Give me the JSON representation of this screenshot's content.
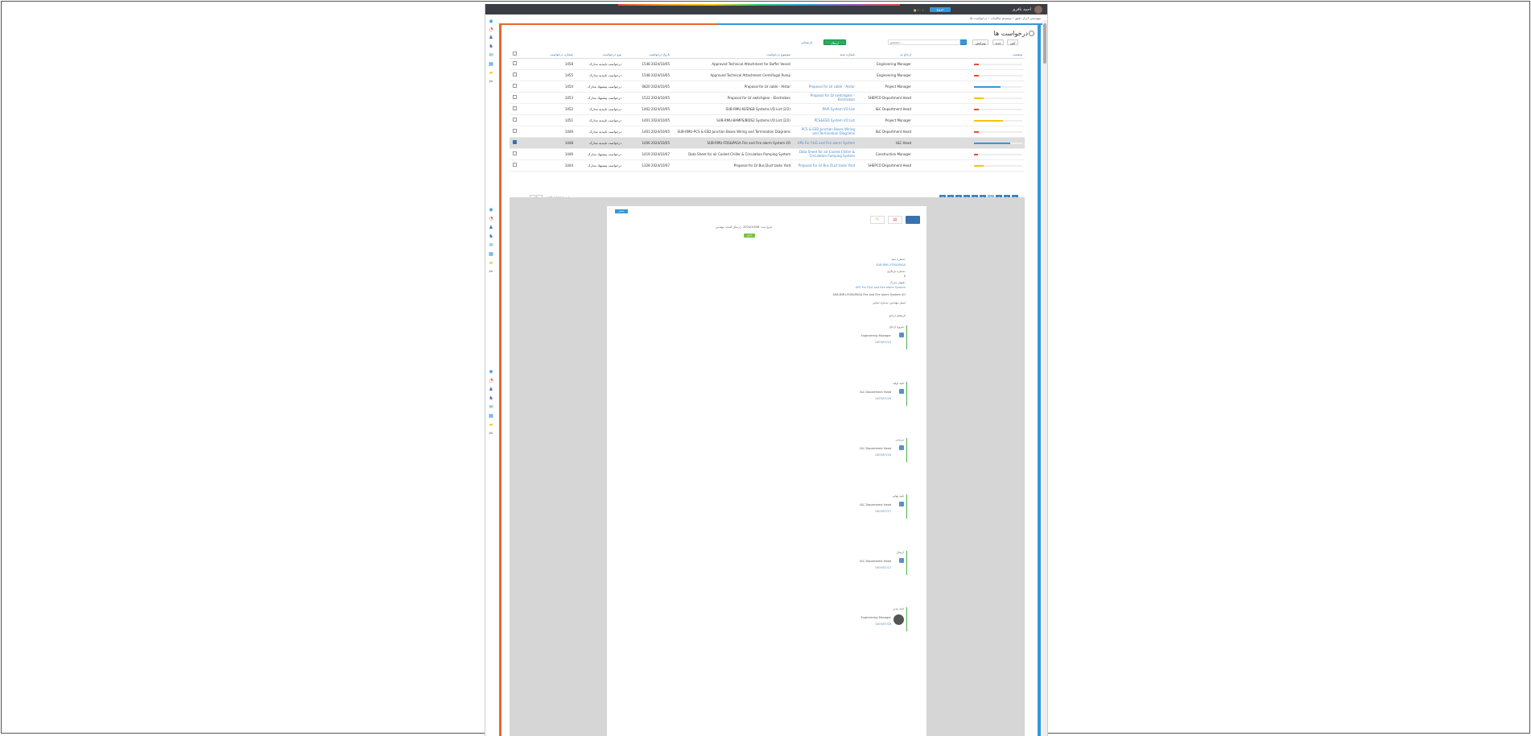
{
  "colors": {
    "accent": "#3498db",
    "orange": "#e8672c",
    "green": "#27ae60",
    "red": "#e74c3c",
    "yellow": "#f1c40f"
  },
  "topbar": {
    "user_name": "احمد باقری",
    "button_label": "خروج",
    "badges": "● ۱۰  ۱"
  },
  "breadcrumb": "مهندسی ابزار دقیق ‹ سیستم مکاتبات ‹ درخواست ها",
  "sidebar": {
    "icons": [
      "dashboard-icon",
      "alert-icon",
      "user-icon",
      "users-icon",
      "mail-icon",
      "calendar-icon",
      "folder-icon",
      "tools-icon"
    ]
  },
  "page": {
    "title": "درخواست ها"
  },
  "toolbar": {
    "buttons": [
      "کپی",
      "جدید",
      "ویرایش",
      "جستجو"
    ],
    "search_placeholder": "جستجو...",
    "green_label": "ارسال",
    "link_label": "بازنشانی"
  },
  "table": {
    "headers": [
      "شماره درخواست",
      "نوع درخواست",
      "تاریخ درخواست",
      "موضوع درخواست",
      "شماره سند",
      "ارجاع به",
      "وضعیت"
    ],
    "rows": [
      {
        "number": "1458",
        "type": "درخواست تاییدیه مدارک",
        "date": "1548 2024/10/05",
        "subject": "Approved Technical Attachment for Buffer Vessel",
        "doc": "",
        "assignee": "Engineering Manager",
        "progress": 0.1,
        "status_color": "#e74c3c",
        "selected": false
      },
      {
        "number": "1455",
        "type": "درخواست تاییدیه مدارک",
        "date": "1548 2024/10/05",
        "subject": "Approved Technical Attachment Centrifugal Pump",
        "doc": "",
        "assignee": "Engineering Manager",
        "progress": 0.1,
        "status_color": "#e74c3c",
        "selected": false
      },
      {
        "number": "1454",
        "type": "درخواست پیشنهاد مدارک",
        "date": "0820 2024/10/05",
        "subject": "Proposal for LV cable - Alstar",
        "doc": "Proposal for LV cable - Alstar",
        "assignee": "Project Manager",
        "progress": 0.55,
        "status_color": "#3498db",
        "selected": false
      },
      {
        "number": "1453",
        "type": "درخواست پیشنهاد مدارک",
        "date": "1522 2024/10/05",
        "subject": "Proposal for LV switchgear - Electroban",
        "doc": "Proposal for LV switchgear - Electroban",
        "assignee": "SHEPCO Department Head",
        "progress": 0.2,
        "status_color": "#f1c40f",
        "selected": false
      },
      {
        "number": "1452",
        "type": "درخواست تاییدیه مدارک",
        "date": "1402 2024/10/05",
        "subject": "SUB-RMU-KESP&B Systems I/O List (2/2)",
        "doc": "PA/R System I/O List",
        "assignee": "I&C Department Head",
        "progress": 0.1,
        "status_color": "#e74c3c",
        "selected": false
      },
      {
        "number": "1451",
        "type": "درخواست تاییدیه مدارک",
        "date": "1401 2024/10/05",
        "subject": "SUB-RMU-BAMPS/BIDS2 Systems I/O List (2/2)",
        "doc": "PCS&ESD System I/O List",
        "assignee": "Project Manager",
        "progress": 0.6,
        "status_color": "#f1c40f",
        "selected": false
      },
      {
        "number": "1449",
        "type": "درخواست تاییدیه مدارک",
        "date": "1401 2024/10/05",
        "subject": "SUB-RMU-PCS & ESD Junction Boxes Wiring and Termination Diagrams",
        "doc": "PCS & ESD Junction Boxes Wiring and Termination Diagrams",
        "assignee": "I&C Department Head",
        "progress": 0.1,
        "status_color": "#e74c3c",
        "selected": false
      },
      {
        "number": "1448",
        "type": "درخواست تاییدیه مدارک",
        "date": "1406 2024/10/05",
        "subject": "SUB-RMU-FDS&PAGA Fire and Fire alarm System I/O",
        "doc": "UPS For F&G and Fire alarm System",
        "assignee": "I&C Head",
        "progress": 0.75,
        "status_color": "#3498db",
        "selected": true
      },
      {
        "number": "1446",
        "type": "درخواست پیشنهاد مدارک",
        "date": "1419 2024/10/07",
        "subject": "Data Sheet for air Cooled Chiller & Circulation Pumping System",
        "doc": "Data Sheet for air Cooled Chiller & Circulation Pumping System",
        "assignee": "Construction Manager",
        "progress": 0.0,
        "status_color": "#e74c3c",
        "selected": false
      },
      {
        "number": "1444",
        "type": "درخواست پیشنهاد مدارک",
        "date": "1328 2024/10/07",
        "subject": "Proposal for LV Bus Duct tasks Yard",
        "doc": "Proposal for LV Bus Duct tasks Yard",
        "assignee": "SHEPCO Department Head",
        "progress": 0.2,
        "status_color": "#f1c40f",
        "selected": false
      }
    ]
  },
  "pager": {
    "pages": [
      "1",
      "2",
      "3",
      "4",
      "5",
      "6",
      "7",
      "8",
      "9",
      "10"
    ],
    "page_size": "10",
    "info": "نمایش 1 تا 10 از 1,425"
  },
  "preview": {
    "header_button": "بیشتر",
    "doc_meta": "تاریخ ثبت: 2024/10/06 - ارسال کننده: مهندس",
    "status_badge": "جاری",
    "field_doc_number_label": "شماره سند:",
    "field_doc_number": "SUB-RMU-FDS&PAGA",
    "field_version_label": "شماره بازنگری:",
    "field_version": "0",
    "field_subject_label": "عنوان مدرک:",
    "field_subject": "UPS For F&G and Fire alarm System",
    "field_desc": "SUB-RMU-FDS&PAGA Fire and Fire alarm System I/O",
    "field_note": "ایمیل مهندس: شماره تماس",
    "history_title": "تاریخچه ارجاع",
    "steps": [
      {
        "title": "شروع ارجاع",
        "person": "Engineering Manager",
        "date": "1403/07/15"
      },
      {
        "title": "تایید اولیه",
        "person": "I&C Department Head",
        "date": "1403/07/16"
      },
      {
        "title": "بررسی",
        "person": "I&C Department Head",
        "date": "1403/07/16"
      },
      {
        "title": "تایید نهایی",
        "person": "I&C Department Head",
        "date": "1403/07/17"
      },
      {
        "title": "ارسال",
        "person": "I&C Department Head",
        "date": "1403/07/17"
      },
      {
        "title": "تایید مدیر",
        "person": "Engineering Manager",
        "date": "1403/07/18"
      }
    ]
  }
}
